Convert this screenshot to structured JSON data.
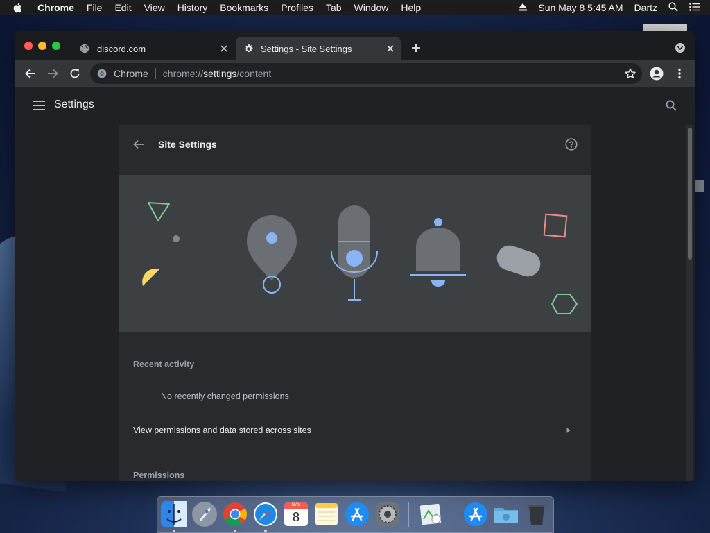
{
  "menubar": {
    "app_name": "Chrome",
    "items": [
      "File",
      "Edit",
      "View",
      "History",
      "Bookmarks",
      "Profiles",
      "Tab",
      "Window",
      "Help"
    ],
    "datetime": "Sun May 8  5:45 AM",
    "user": "Dartz"
  },
  "tabs": [
    {
      "title": "discord.com",
      "active": false
    },
    {
      "title": "Settings - Site Settings",
      "active": true
    }
  ],
  "omnibox": {
    "chip_label": "Chrome",
    "url_prefix": "chrome://",
    "url_host": "settings",
    "url_path": "/content"
  },
  "settings": {
    "title": "Settings",
    "page_title": "Site Settings",
    "recent_activity_label": "Recent activity",
    "no_recent_text": "No recently changed permissions",
    "view_permissions_label": "View permissions and data stored across sites",
    "permissions_label": "Permissions"
  },
  "dock": {
    "apps": [
      "finder-icon",
      "launchpad-icon",
      "chrome-icon",
      "safari-icon",
      "calendar-icon",
      "notes-icon",
      "app-store-icon",
      "system-preferences-icon",
      "preview-icon",
      "app-store-folder-icon",
      "downloads-folder-icon",
      "trash-icon"
    ],
    "calendar_month": "MAY",
    "calendar_day": "8"
  },
  "colors": {
    "accent_blue": "#8ab4f8",
    "illustration_gray": "#6b6e73",
    "background": "#202124"
  }
}
